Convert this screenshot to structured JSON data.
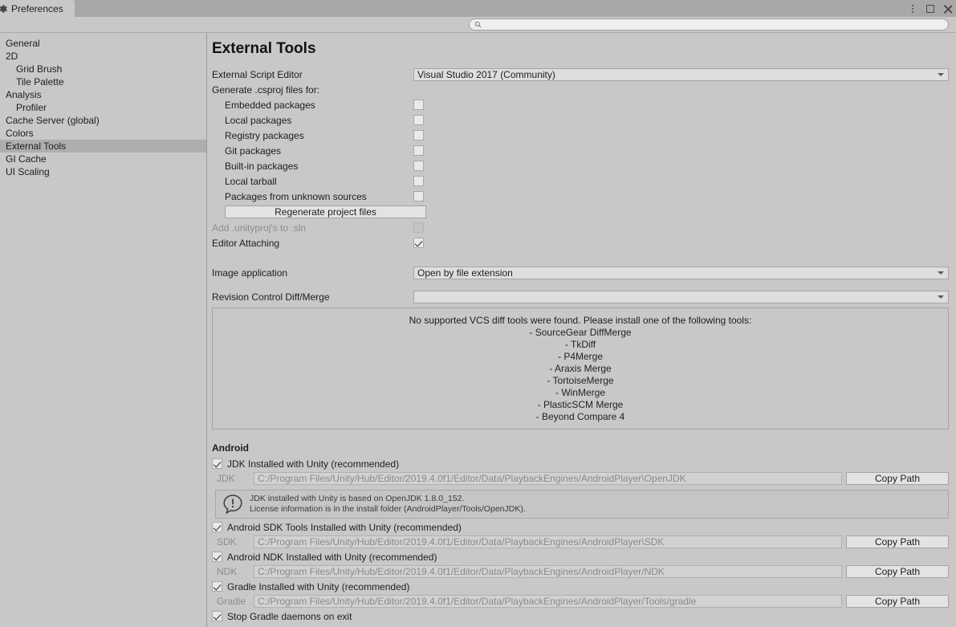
{
  "window": {
    "tab_label": "Preferences",
    "tab_icon": "gear-icon",
    "controls": {
      "menu": "vertical-dots-icon",
      "maximize": "maximize-icon",
      "close": "close-icon"
    }
  },
  "search": {
    "value": "",
    "placeholder": "",
    "icon": "search-icon"
  },
  "sidebar": {
    "items": [
      {
        "label": "General",
        "indent": false,
        "selected": false
      },
      {
        "label": "2D",
        "indent": false,
        "selected": false
      },
      {
        "label": "Grid Brush",
        "indent": true,
        "selected": false
      },
      {
        "label": "Tile Palette",
        "indent": true,
        "selected": false
      },
      {
        "label": "Analysis",
        "indent": false,
        "selected": false
      },
      {
        "label": "Profiler",
        "indent": true,
        "selected": false
      },
      {
        "label": "Cache Server (global)",
        "indent": false,
        "selected": false
      },
      {
        "label": "Colors",
        "indent": false,
        "selected": false
      },
      {
        "label": "External Tools",
        "indent": false,
        "selected": true
      },
      {
        "label": "GI Cache",
        "indent": false,
        "selected": false
      },
      {
        "label": "UI Scaling",
        "indent": false,
        "selected": false
      }
    ]
  },
  "main": {
    "title": "External Tools",
    "script_editor": {
      "label": "External Script Editor",
      "value": "Visual Studio 2017 (Community)"
    },
    "csproj": {
      "label": "Generate .csproj files for:",
      "options": [
        {
          "label": "Embedded packages",
          "checked": false
        },
        {
          "label": "Local packages",
          "checked": false
        },
        {
          "label": "Registry packages",
          "checked": false
        },
        {
          "label": "Git packages",
          "checked": false
        },
        {
          "label": "Built-in packages",
          "checked": false
        },
        {
          "label": "Local tarball",
          "checked": false
        },
        {
          "label": "Packages from unknown sources",
          "checked": false
        }
      ],
      "regenerate_label": "Regenerate project files"
    },
    "add_unityproj": {
      "label": "Add .unityproj's to .sln",
      "checked": false,
      "disabled": true
    },
    "editor_attaching": {
      "label": "Editor Attaching",
      "checked": true
    },
    "image_application": {
      "label": "Image application",
      "value": "Open by file extension"
    },
    "revision_control": {
      "label": "Revision Control Diff/Merge",
      "value": ""
    },
    "vcs_help": {
      "message": "No supported VCS diff tools were found. Please install one of the following tools:",
      "tools": [
        "- SourceGear DiffMerge",
        "- TkDiff",
        "- P4Merge",
        "- Araxis Merge",
        "- TortoiseMerge",
        "- WinMerge",
        "- PlasticSCM Merge",
        "- Beyond Compare 4"
      ]
    },
    "android": {
      "section_title": "Android",
      "jdk": {
        "checkbox_label": "JDK Installed with Unity (recommended)",
        "checked": true,
        "field_label": "JDK",
        "path": "C:/Program Files/Unity/Hub/Editor/2019.4.0f1/Editor/Data/PlaybackEngines/AndroidPlayer\\OpenJDK",
        "copy_label": "Copy Path",
        "info_icon": "warning-bubble-icon",
        "info_line1": "JDK installed with Unity is based on OpenJDK 1.8.0_152.",
        "info_line2": "License information is in the install folder (AndroidPlayer/Tools/OpenJDK)."
      },
      "sdk": {
        "checkbox_label": "Android SDK Tools Installed with Unity (recommended)",
        "checked": true,
        "field_label": "SDK",
        "path": "C:/Program Files/Unity/Hub/Editor/2019.4.0f1/Editor/Data/PlaybackEngines/AndroidPlayer\\SDK",
        "copy_label": "Copy Path"
      },
      "ndk": {
        "checkbox_label": "Android NDK Installed with Unity (recommended)",
        "checked": true,
        "field_label": "NDK",
        "path": "C:/Program Files/Unity/Hub/Editor/2019.4.0f1/Editor/Data/PlaybackEngines/AndroidPlayer/NDK",
        "copy_label": "Copy Path"
      },
      "gradle": {
        "checkbox_label": "Gradle Installed with Unity (recommended)",
        "checked": true,
        "field_label": "Gradle",
        "path": "C:/Program Files/Unity/Hub/Editor/2019.4.0f1/Editor/Data/PlaybackEngines/AndroidPlayer/Tools/gradle",
        "copy_label": "Copy Path"
      },
      "stop_daemons": {
        "label": "Stop Gradle daemons on exit",
        "checked": true
      }
    }
  },
  "colors": {
    "window_bg": "#c8c8c8",
    "titlebar_bg": "#a8a8a8",
    "selection": "#aeaeae",
    "field_bg": "#dedede",
    "text": "#1d1d1d",
    "disabled_text": "#8c8c8c"
  }
}
